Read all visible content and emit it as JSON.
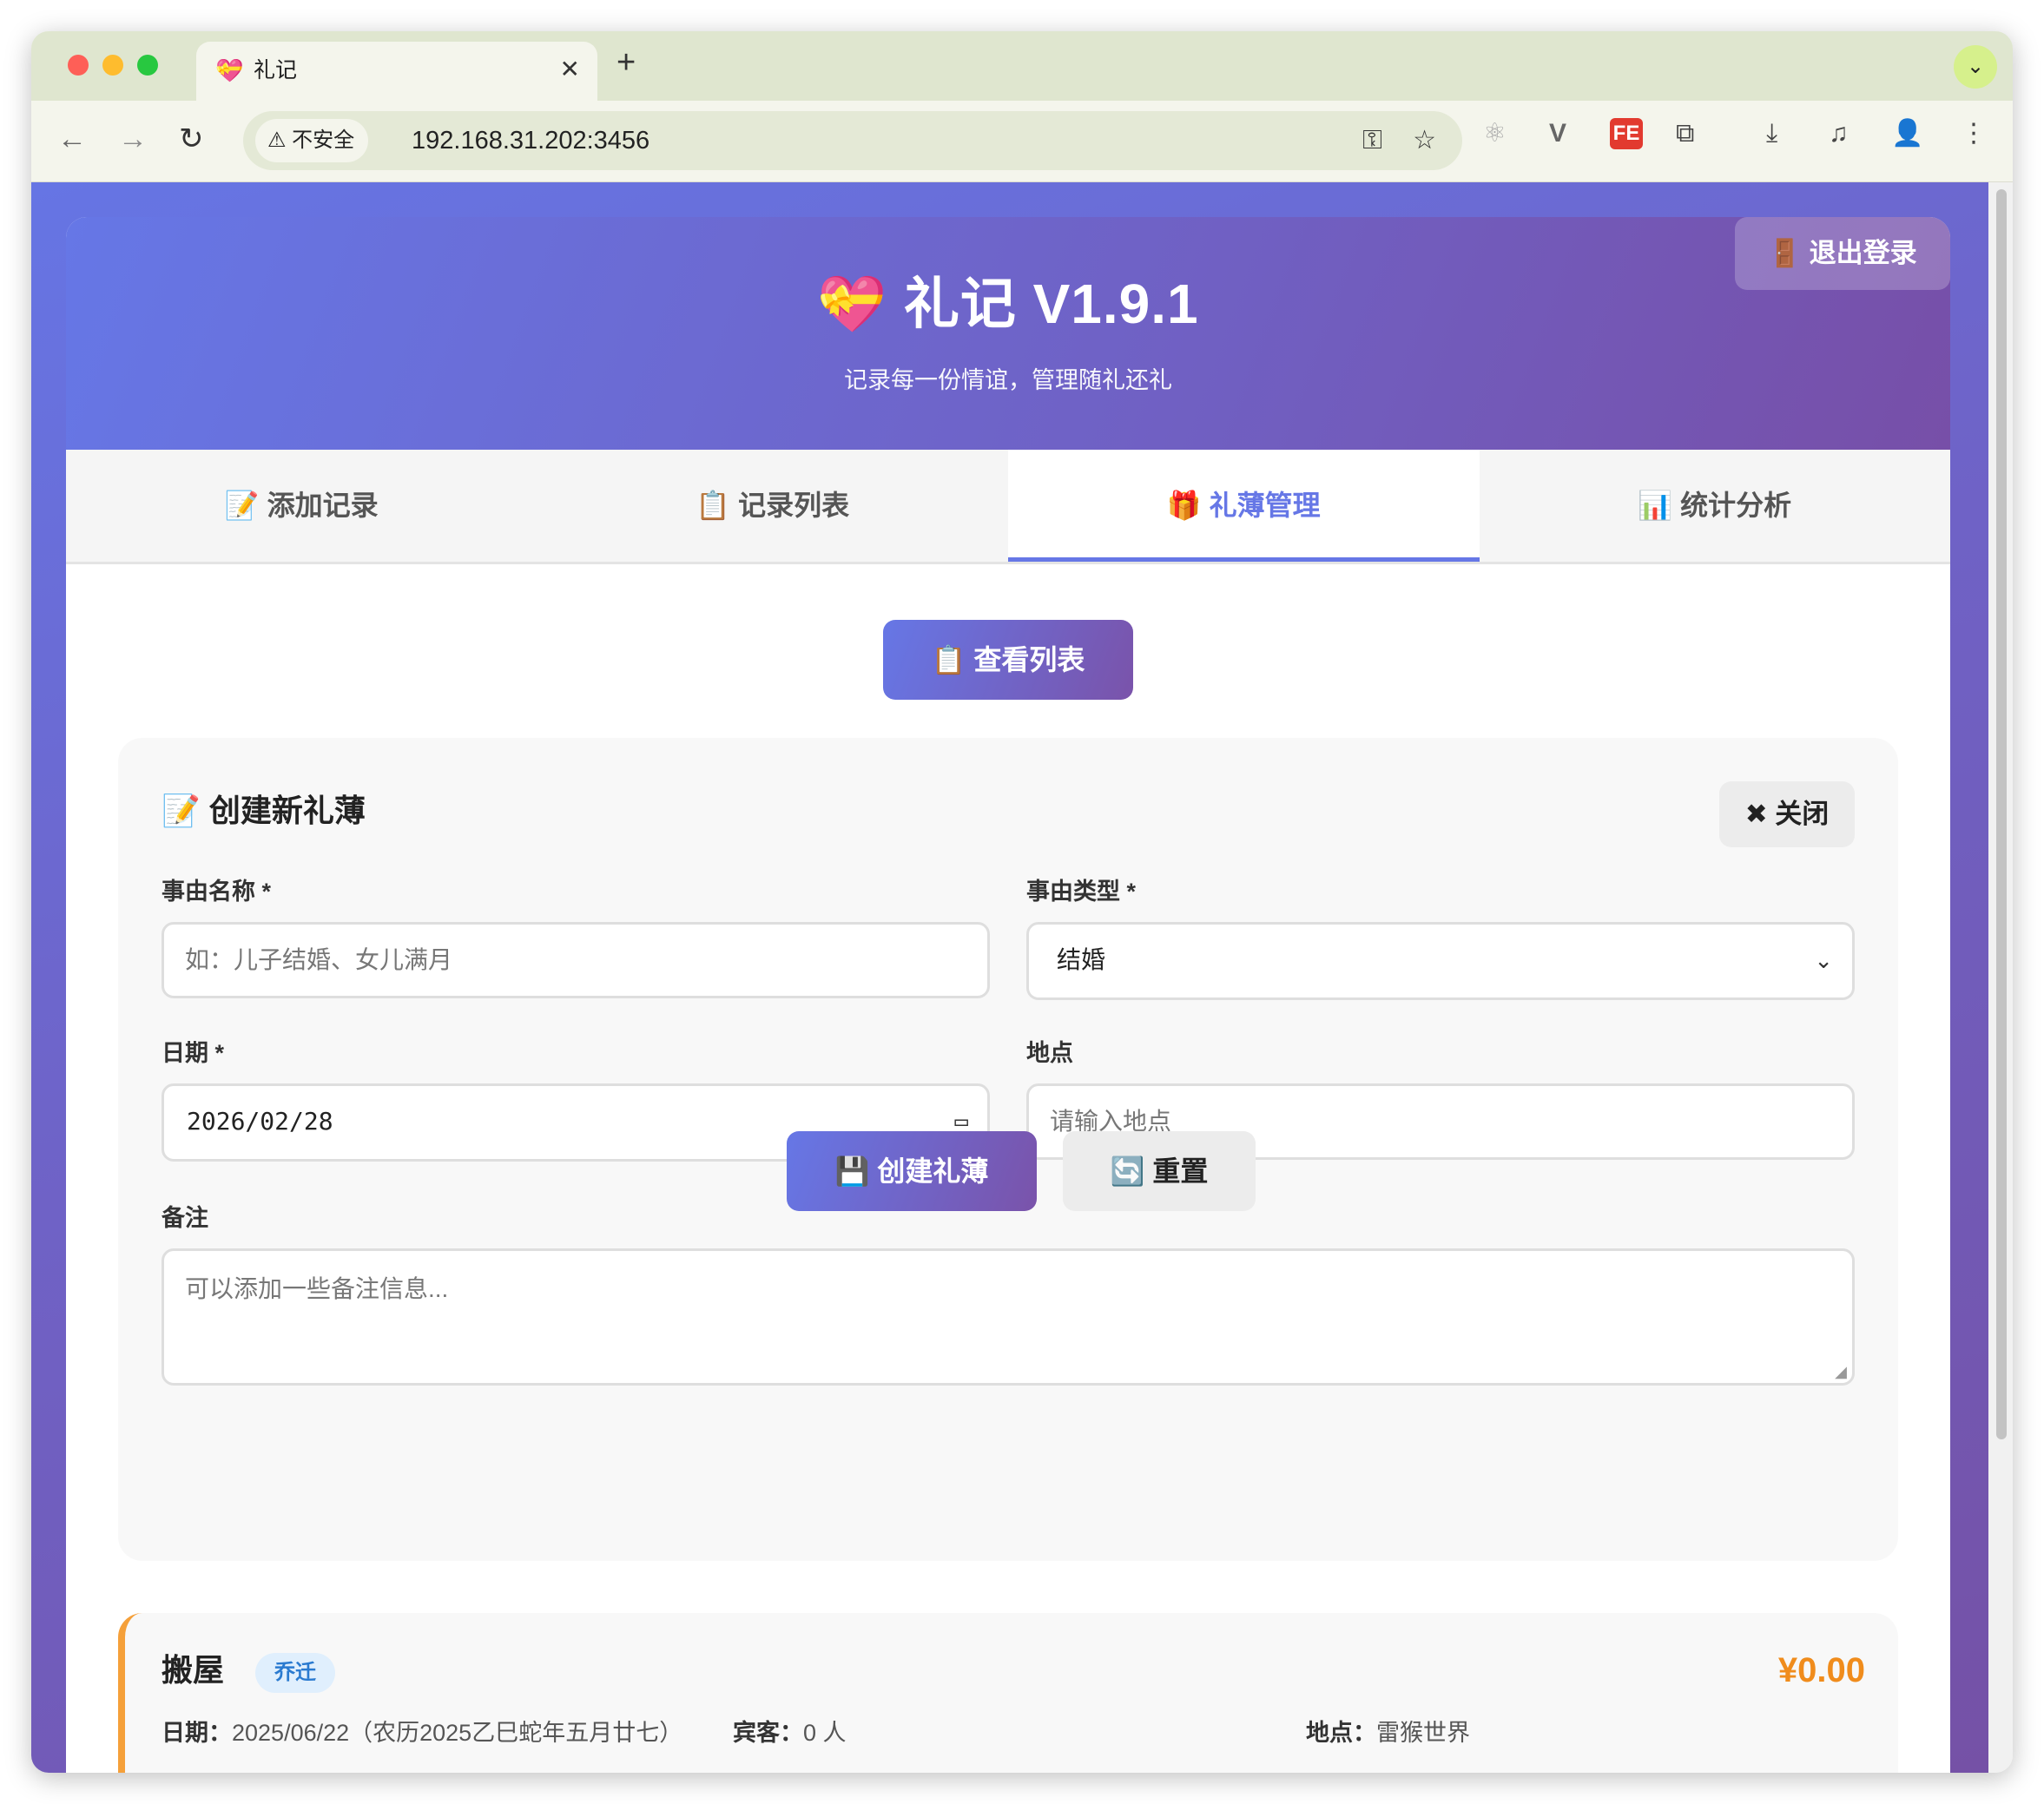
{
  "browser": {
    "tab_icon": "💝",
    "tab_title": "礼记",
    "tab_close": "✕",
    "new_tab": "+",
    "tab_menu": "⌄",
    "nav": {
      "back": "←",
      "forward": "→",
      "reload": "↻"
    },
    "security_label": "⚠ 不安全",
    "url": "192.168.31.202:3456",
    "omni_icons": {
      "key": "⚿",
      "star": "☆"
    },
    "extensions": [
      "⚛",
      "V",
      "FE",
      "⧉",
      "⤓",
      "♫",
      "👤",
      "⋮"
    ]
  },
  "header": {
    "title": "💝 礼记 V1.9.1",
    "subtitle": "记录每一份情谊，管理随礼还礼",
    "logout": "🚪 退出登录"
  },
  "tabs": [
    {
      "label": "📝 添加记录",
      "active": false
    },
    {
      "label": "📋 记录列表",
      "active": false
    },
    {
      "label": "🎁 礼薄管理",
      "active": true
    },
    {
      "label": "📊 统计分析",
      "active": false
    }
  ],
  "actions": {
    "view_list": "📋 查看列表"
  },
  "form": {
    "title": "📝 创建新礼薄",
    "close": "✖ 关闭",
    "event_name": {
      "label": "事由名称 *",
      "placeholder": "如：儿子结婚、女儿满月"
    },
    "event_type": {
      "label": "事由类型 *",
      "value": "结婚"
    },
    "date": {
      "label": "日期 *",
      "value": "2026/02/28"
    },
    "location": {
      "label": "地点",
      "placeholder": "请输入地点"
    },
    "notes": {
      "label": "备注",
      "placeholder": "可以添加一些备注信息..."
    },
    "submit": "💾 创建礼薄",
    "reset": "🔄 重置"
  },
  "records": [
    {
      "name": "搬屋",
      "tag": "乔迁",
      "amount": "¥0.00",
      "date_label": "日期：",
      "date_value": "2025/06/22（农历2025乙巳蛇年五月廿七）",
      "guests_label": "宾客：",
      "guests_value": "0 人",
      "location_label": "地点：",
      "location_value": "雷猴世界"
    }
  ],
  "colors": {
    "accent": "#6677e6",
    "accent_end": "#7a53aa",
    "record_border": "#f5a03a",
    "amount": "#f08c1c",
    "tag_bg": "#e0effd",
    "tag_text": "#2a7ad0"
  }
}
